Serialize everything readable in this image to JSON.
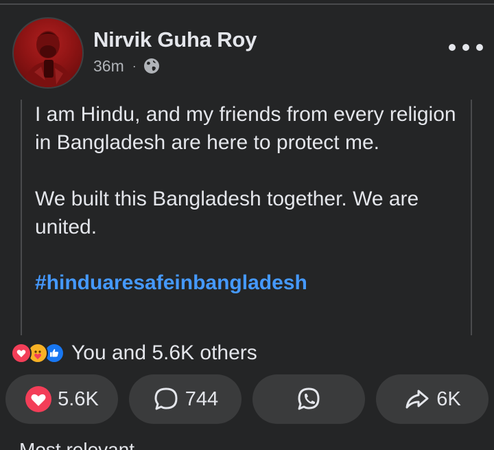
{
  "post": {
    "author_name": "Nirvik Guha Roy",
    "timestamp": "36m",
    "meta_separator": "·",
    "privacy_icon": "globe-icon",
    "body_paragraph_1": "I am Hindu, and my friends from every religion in Bangladesh are here to protect me.",
    "body_paragraph_2": "We built this Bangladesh together. We are united.",
    "hashtag": "#hinduaresafeinbangladesh"
  },
  "reactions": {
    "icons": [
      "love-reaction-icon",
      "care-reaction-icon",
      "like-reaction-icon"
    ],
    "summary": "You and 5.6K others"
  },
  "actions": {
    "react_count": "5.6K",
    "comment_count": "744",
    "share_count": "6K"
  },
  "below": {
    "partial_text": "Most relevant"
  },
  "colors": {
    "background": "#242526",
    "pill": "#3a3b3c",
    "hashtag": "#4599ff",
    "love": "#f33e58",
    "like": "#1877f2",
    "care": "#f7b125"
  }
}
